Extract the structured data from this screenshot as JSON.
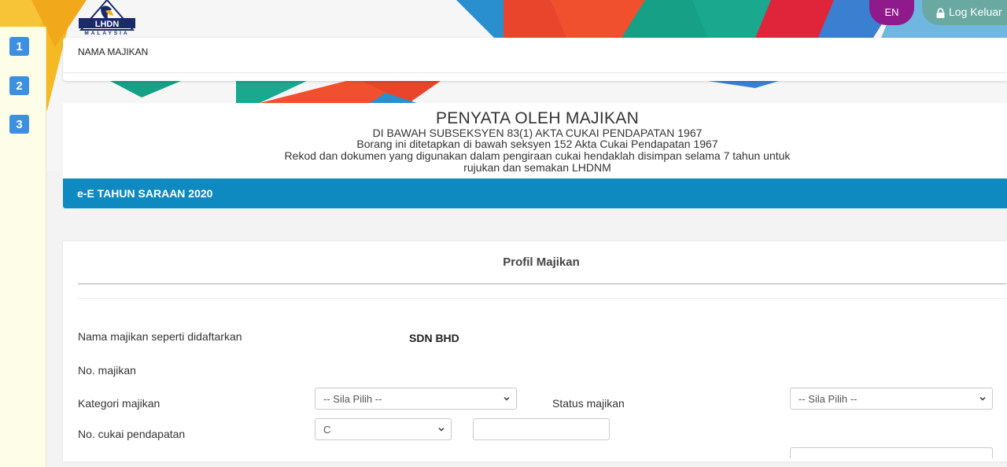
{
  "header": {
    "logo_text": "LHDN",
    "logo_subtext": "MALAYSIA",
    "lang_label": "EN",
    "logout_label": "Log Keluar"
  },
  "steps": [
    "1",
    "2",
    "3"
  ],
  "employer_bar": {
    "label": "NAMA MAJIKAN"
  },
  "title_card": {
    "title": "PENYATA OLEH MAJIKAN",
    "line1": "DI BAWAH SUBSEKSYEN 83(1) AKTA CUKAI PENDAPATAN 1967",
    "line2": "Borang ini ditetapkan di bawah seksyen 152 Akta Cukai Pendapatan 1967",
    "line3": "Rekod dan dokumen yang digunakan dalam pengiraan cukai hendaklah disimpan selama 7 tahun untuk",
    "line4": "rujukan dan semakan LHDNM"
  },
  "year_bar": {
    "label": "e-E TAHUN SARAAN 2020"
  },
  "profile": {
    "title": "Profil Majikan",
    "fields": {
      "nama_label": "Nama majikan seperti didaftarkan",
      "nama_value": "SDN BHD",
      "no_label": "No. majikan",
      "kategori_label": "Kategori majikan",
      "kategori_value": "-- Sila Pilih --",
      "status_label": "Status majikan",
      "status_value": "-- Sila Pilih --",
      "cukai_label": "No. cukai pendapatan",
      "cukai_prefix_value": "C",
      "cukai_number_value": ""
    }
  },
  "colors": {
    "accent_blue": "#0e8ac0",
    "step_blue": "#3d8fe0",
    "lang_purple": "#8e1a8c",
    "logout_teal": "#6aa9a2"
  }
}
